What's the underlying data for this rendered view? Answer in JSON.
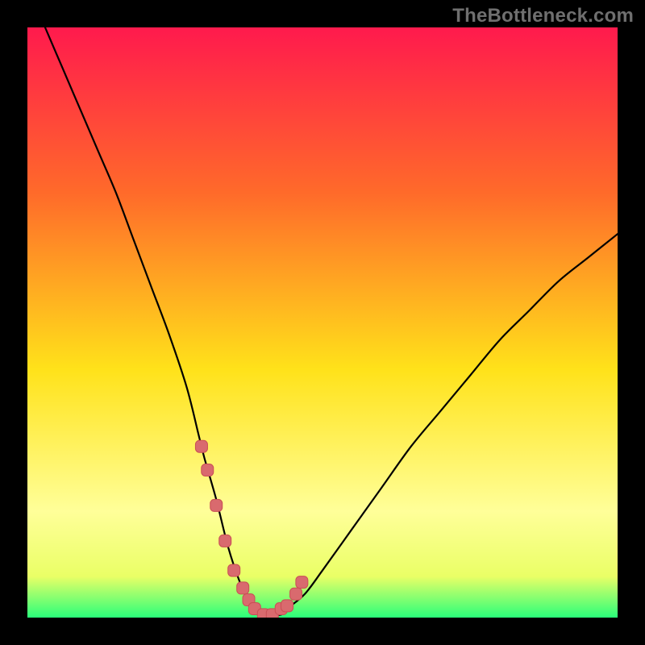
{
  "watermark": "TheBottleneck.com",
  "colors": {
    "frame": "#000000",
    "gradient_top": "#ff1a4d",
    "gradient_mid_upper": "#ff6a2a",
    "gradient_mid": "#ffe21a",
    "gradient_lower": "#ffff99",
    "gradient_bottom": "#2aff7a",
    "curve": "#000000",
    "marker_fill": "#d96a6e",
    "marker_stroke": "#c94f55"
  },
  "chart_data": {
    "type": "line",
    "title": "",
    "xlabel": "",
    "ylabel": "",
    "xlim": [
      0,
      100
    ],
    "ylim": [
      0,
      100
    ],
    "series": [
      {
        "name": "bottleneck-curve",
        "x": [
          3,
          6,
          9,
          12,
          15,
          18,
          21,
          24,
          27,
          29,
          30,
          32,
          34,
          36,
          37.5,
          38.5,
          40,
          43,
          44,
          47,
          50,
          55,
          60,
          65,
          70,
          75,
          80,
          85,
          90,
          95,
          100
        ],
        "y": [
          100,
          93,
          86,
          79,
          72,
          64,
          56,
          48,
          39,
          31,
          27,
          20,
          12,
          6,
          3,
          1.5,
          0.5,
          0.5,
          1.5,
          4,
          8,
          15,
          22,
          29,
          35,
          41,
          47,
          52,
          57,
          61,
          65
        ]
      }
    ],
    "markers": [
      {
        "name": "left-cluster",
        "x": [
          29.5,
          30.5,
          32,
          33.5,
          35,
          36.5,
          37.5
        ],
        "y": [
          29,
          25,
          19,
          13,
          8,
          5,
          3
        ]
      },
      {
        "name": "valley-floor",
        "x": [
          38.5,
          40,
          41.5,
          43
        ],
        "y": [
          1.5,
          0.5,
          0.5,
          1.5
        ]
      },
      {
        "name": "right-cluster",
        "x": [
          44,
          45.5,
          46.5
        ],
        "y": [
          2,
          4,
          6
        ]
      }
    ]
  }
}
